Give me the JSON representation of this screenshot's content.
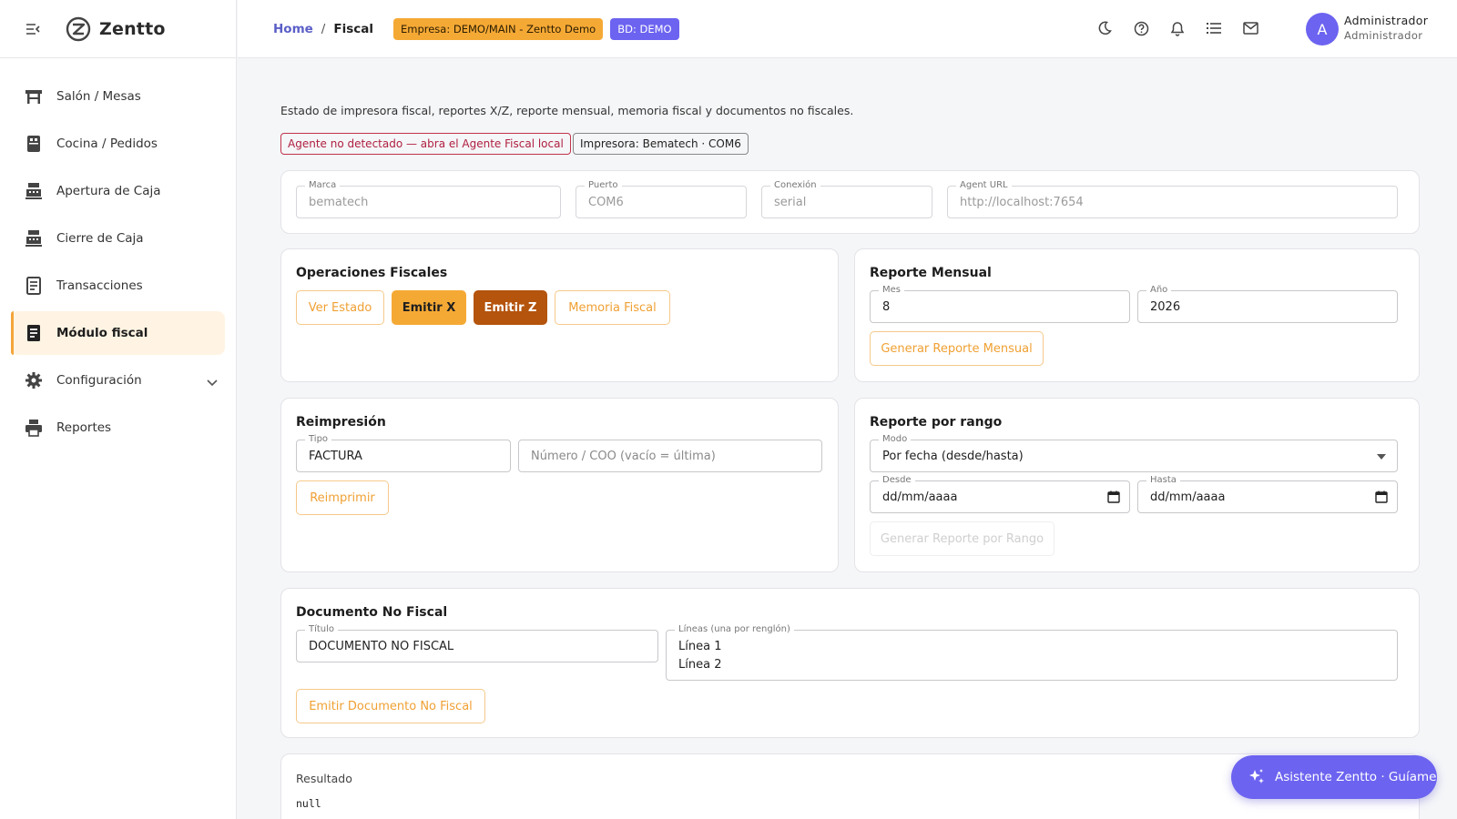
{
  "app": {
    "name": "Zentto"
  },
  "colors": {
    "accent": "#f5a935",
    "brand": "#6c63f0",
    "dark_button": "#b4540d",
    "danger": "#c0334a"
  },
  "sidebar": {
    "items": [
      {
        "label": "Salón / Mesas",
        "icon": "table-chairs-icon"
      },
      {
        "label": "Cocina / Pedidos",
        "icon": "kitchen-icon"
      },
      {
        "label": "Apertura de Caja",
        "icon": "cash-register-icon"
      },
      {
        "label": "Cierre de Caja",
        "icon": "cash-register-icon"
      },
      {
        "label": "Transacciones",
        "icon": "receipt-icon"
      },
      {
        "label": "Módulo fiscal",
        "icon": "fiscal-receipt-icon",
        "active": true
      },
      {
        "label": "Configuración",
        "icon": "gear-icon",
        "expandable": true
      },
      {
        "label": "Reportes",
        "icon": "printer-icon"
      }
    ]
  },
  "header": {
    "breadcrumb": {
      "home": "Home",
      "separator": "/",
      "current": "Fiscal"
    },
    "empresa_badge": "Empresa: DEMO/MAIN - Zentto Demo",
    "bd_badge": "BD: DEMO",
    "icons": [
      "moon-icon",
      "help-icon",
      "bell-icon",
      "list-icon",
      "mail-icon"
    ],
    "user": {
      "initial": "A",
      "name": "Administrador",
      "role": "Administrador"
    }
  },
  "page": {
    "description": "Estado de impresora fiscal, reportes X/Z, reporte mensual, memoria fiscal y documentos no fiscales.",
    "agent_status": "Agente no detectado — abra el Agente Fiscal local",
    "printer_status": "Impresora: Bematech · COM6"
  },
  "config": {
    "marca": {
      "label": "Marca",
      "value": "bematech"
    },
    "puerto": {
      "label": "Puerto",
      "value": "COM6"
    },
    "conexion": {
      "label": "Conexión",
      "value": "serial"
    },
    "agent_url": {
      "label": "Agent URL",
      "value": "http://localhost:7654"
    }
  },
  "operaciones": {
    "title": "Operaciones Fiscales",
    "ver_estado": "Ver Estado",
    "emitir_x": "Emitir X",
    "emitir_z": "Emitir Z",
    "memoria": "Memoria Fiscal"
  },
  "reporte_mensual": {
    "title": "Reporte Mensual",
    "mes_label": "Mes",
    "mes_value": "8",
    "anio_label": "Año",
    "anio_value": "2026",
    "button": "Generar Reporte Mensual"
  },
  "reimpresion": {
    "title": "Reimpresión",
    "tipo_label": "Tipo",
    "tipo_value": "FACTURA",
    "numero_placeholder": "Número / COO (vacío = última)",
    "button": "Reimprimir"
  },
  "reporte_rango": {
    "title": "Reporte por rango",
    "modo_label": "Modo",
    "modo_value": "Por fecha (desde/hasta)",
    "desde_label": "Desde",
    "desde_value": "dd/mm/aaaa",
    "hasta_label": "Hasta",
    "hasta_value": "dd/mm/aaaa",
    "button": "Generar Reporte por Rango"
  },
  "no_fiscal": {
    "title": "Documento No Fiscal",
    "titulo_label": "Título",
    "titulo_value": "DOCUMENTO NO FISCAL",
    "lineas_label": "Líneas (una por renglón)",
    "linea1": "Línea 1",
    "linea2": "Línea 2",
    "button": "Emitir Documento No Fiscal"
  },
  "resultado": {
    "label": "Resultado",
    "value": "null"
  },
  "assistant": {
    "label": "Asistente Zentto · Guíame"
  }
}
